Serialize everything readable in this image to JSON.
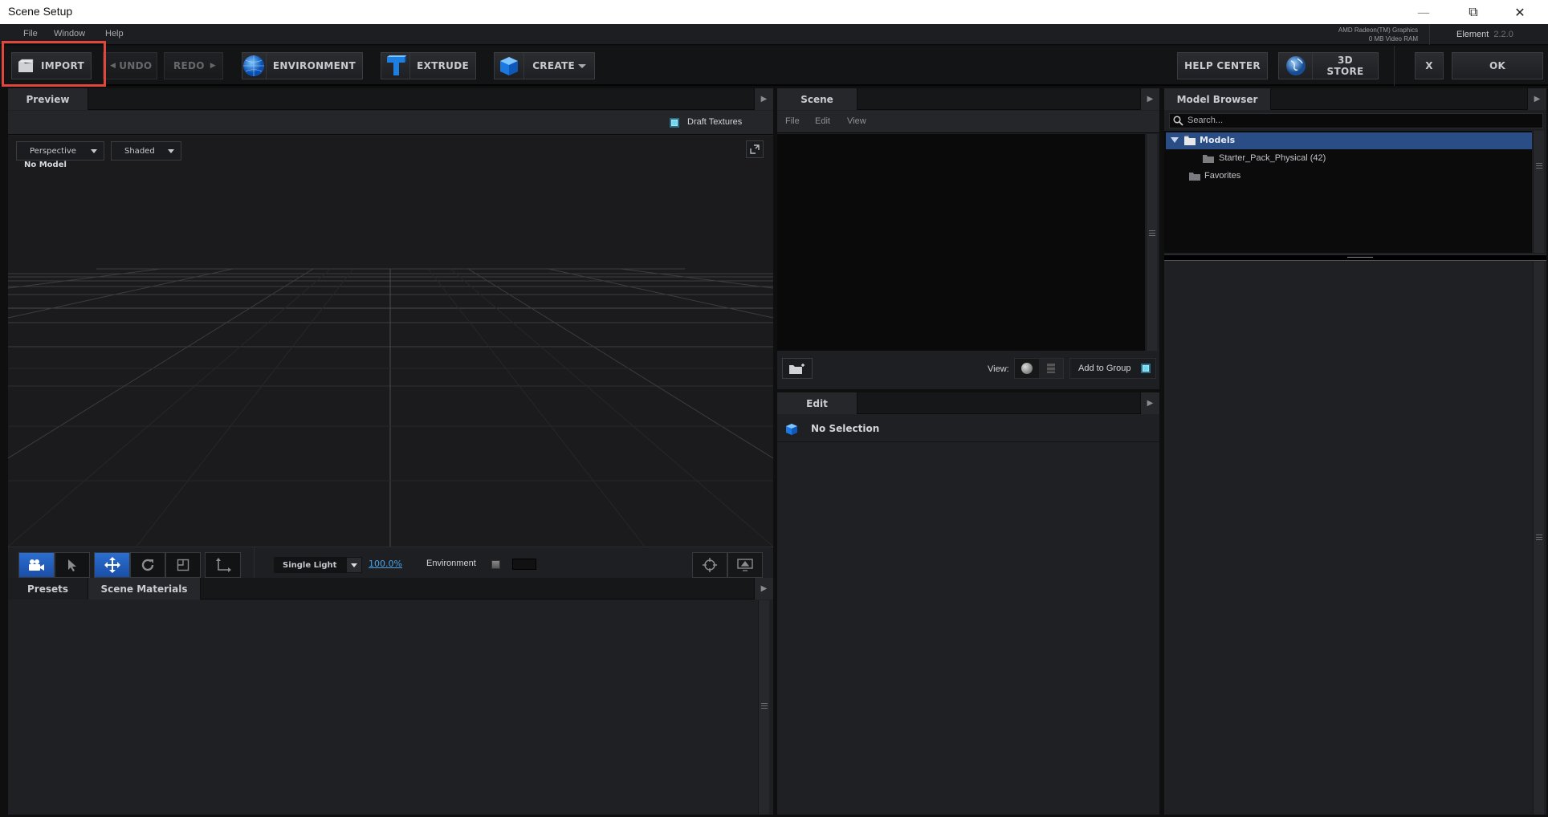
{
  "window": {
    "title": "Scene Setup",
    "minimize": "—",
    "restore": "⧉",
    "close": "✕"
  },
  "menubar": {
    "items": [
      "File",
      "Window",
      "Help"
    ],
    "gpu_name": "AMD Radeon(TM) Graphics",
    "gpu_vram": "0 MB Video RAM",
    "app_name": "Element",
    "app_version": "2.2.0"
  },
  "toolbar": {
    "import": "IMPORT",
    "undo": "UNDO",
    "redo": "REDO",
    "environment": "ENVIRONMENT",
    "extrude": "EXTRUDE",
    "create": "CREATE",
    "help_center": "HELP CENTER",
    "store": "3D STORE",
    "cancel": "X",
    "ok": "OK"
  },
  "preview": {
    "tab": "Preview",
    "draft_textures": "Draft Textures",
    "draft_textures_checked": true,
    "view_mode": "Perspective",
    "shade_mode": "Shaded",
    "status": "No Model",
    "light_mode": "Single Light",
    "light_intensity": "100.0%",
    "environment_label": "Environment",
    "environment_checked": false
  },
  "lower_left": {
    "tabs": [
      "Presets",
      "Scene Materials"
    ]
  },
  "scene": {
    "tab": "Scene",
    "menu": [
      "File",
      "Edit",
      "View"
    ],
    "view_label": "View:",
    "add_to_group": "Add to Group",
    "add_to_group_checked": true
  },
  "edit": {
    "tab": "Edit",
    "selection": "No Selection"
  },
  "model_browser": {
    "tab": "Model Browser",
    "search_placeholder": "Search...",
    "tree": [
      {
        "label": "Models",
        "expanded": true,
        "selected": true,
        "level": 0
      },
      {
        "label": "Starter_Pack_Physical (42)",
        "level": 1
      },
      {
        "label": "Favorites",
        "level": 0
      }
    ]
  },
  "colors": {
    "accent_blue": "#2b6ed1",
    "selection": "#2a4d86",
    "highlight_box": "#e0463c",
    "checkbox": "#6fd6ef"
  }
}
